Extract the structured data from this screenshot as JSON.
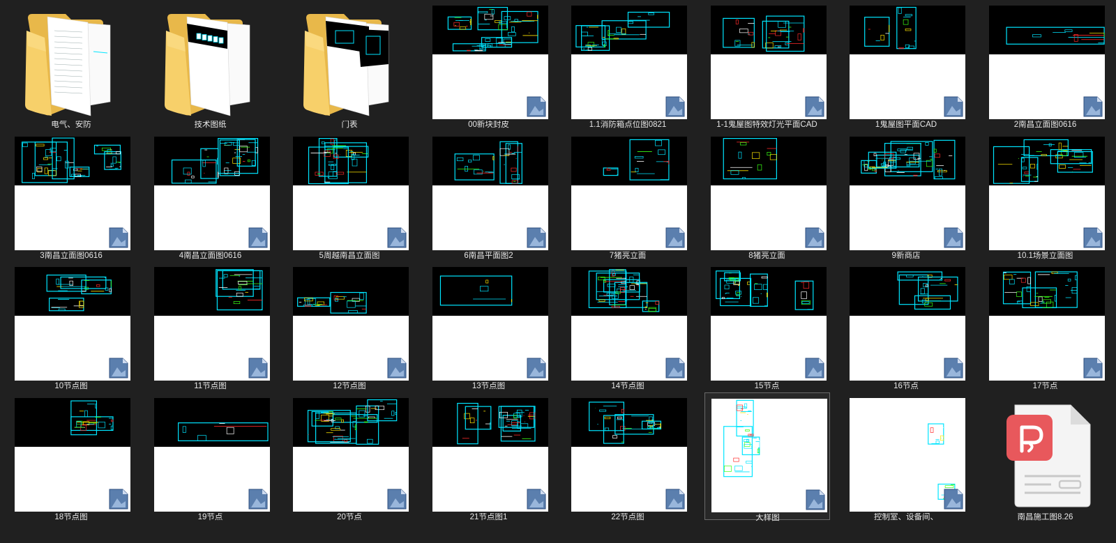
{
  "view": "large-icons",
  "items": [
    {
      "name": "电气、安防",
      "type": "folder"
    },
    {
      "name": "技术图纸",
      "type": "folder"
    },
    {
      "name": "门表",
      "type": "folder"
    },
    {
      "name": "00新块封皮",
      "type": "dwg"
    },
    {
      "name": "1.1消防箱点位图0821",
      "type": "dwg"
    },
    {
      "name": "1-1鬼屋图特效灯光平面CAD",
      "type": "dwg"
    },
    {
      "name": "1鬼屋图平面CAD",
      "type": "dwg"
    },
    {
      "name": "2南昌立面图0616",
      "type": "dwg"
    },
    {
      "name": "3南昌立面图0616",
      "type": "dwg"
    },
    {
      "name": "4南昌立面图0616",
      "type": "dwg"
    },
    {
      "name": "5周越南昌立面图",
      "type": "dwg"
    },
    {
      "name": "6南昌平面图2",
      "type": "dwg"
    },
    {
      "name": "7猪亮立面",
      "type": "dwg"
    },
    {
      "name": "8猪亮立面",
      "type": "dwg"
    },
    {
      "name": "9新商店",
      "type": "dwg"
    },
    {
      "name": "10.1场景立面图",
      "type": "dwg"
    },
    {
      "name": "10节点图",
      "type": "dwg"
    },
    {
      "name": "11节点图",
      "type": "dwg"
    },
    {
      "name": "12节点图",
      "type": "dwg"
    },
    {
      "name": "13节点图",
      "type": "dwg"
    },
    {
      "name": "14节点图",
      "type": "dwg"
    },
    {
      "name": "15节点",
      "type": "dwg"
    },
    {
      "name": "16节点",
      "type": "dwg"
    },
    {
      "name": "17节点",
      "type": "dwg"
    },
    {
      "name": "18节点图",
      "type": "dwg"
    },
    {
      "name": "19节点",
      "type": "dwg"
    },
    {
      "name": "20节点",
      "type": "dwg"
    },
    {
      "name": "21节点图1",
      "type": "dwg"
    },
    {
      "name": "22节点图",
      "type": "dwg"
    },
    {
      "name": "大样图",
      "type": "dwg",
      "selected": true,
      "white": true
    },
    {
      "name": "控制室、设备间、",
      "type": "dwg",
      "white": true
    },
    {
      "name": "南昌施工图8.26",
      "type": "pdf"
    }
  ],
  "colors": {
    "background": "#202020",
    "label": "#e6e6e6",
    "cad_cyan": "#00e5ff",
    "cad_green": "#39ff14",
    "cad_red": "#ff2a2a",
    "cad_yellow": "#ffe600",
    "folder": "#f2c95c",
    "pdf_red": "#e8585c"
  },
  "icons": {
    "folder": "folder-icon",
    "dwg_badge": "dwg-file-badge-icon",
    "pdf": "pdf-file-icon"
  }
}
